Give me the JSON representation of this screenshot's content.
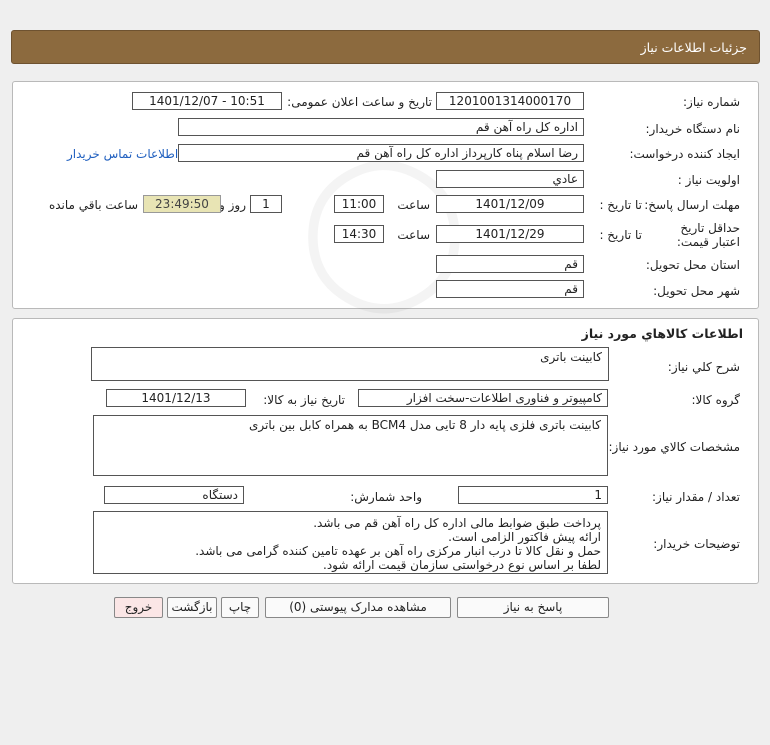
{
  "header": {
    "title": "جزئیات اطلاعات نیاز"
  },
  "need": {
    "need_number_label": "شماره نیاز:",
    "need_number": "1201001314000170",
    "announce_label": "تاریخ و ساعت اعلان عمومی:",
    "announce_value": "1401/12/07 - 10:51",
    "buyer_org_label": "نام دستگاه خریدار:",
    "buyer_org": "اداره کل  راه آهن قم",
    "creator_label": "ایجاد کننده درخواست:",
    "creator": "رضا اسلام پناه کارپرداز اداره کل  راه آهن قم",
    "contact_link": "اطلاعات تماس خریدار",
    "priority_label": "اولویت نیاز :",
    "priority": "عادي",
    "deadline_label": "مهلت ارسال پاسخ:",
    "until_date_label": "تا تاریخ :",
    "deadline_date": "1401/12/09",
    "time_label": "ساعت",
    "deadline_time": "11:00",
    "days_value": "1",
    "days_label": "روز و",
    "remaining_time": "23:49:50",
    "remaining_label": "ساعت باقي مانده",
    "validity_label": "حداقل تاریخ اعتبار قیمت:",
    "validity_date": "1401/12/29",
    "validity_time": "14:30",
    "province_label": "استان محل تحویل:",
    "province": "قم",
    "city_label": "شهر محل تحویل:",
    "city": "قم"
  },
  "goods": {
    "section_title": "اطلاعات کالاهاي مورد نياز",
    "summary_label": "شرح کلي نياز:",
    "summary": "کابینت باتری",
    "group_label": "گروه کالا:",
    "group": "کامپیوتر و فناوری اطلاعات-سخت افزار",
    "need_date_label": "تاريخ نياز به کالا:",
    "need_date": "1401/12/13",
    "specs_label": "مشخصات کالاي مورد نياز:",
    "specs": "کابینت باتری فلزی پایه دار 8 تایی مدل BCM4 به همراه کابل بین باتری",
    "qty_label": "تعداد / مقدار نياز:",
    "qty": "1",
    "unit_label": "واحد شمارش:",
    "unit": "دستگاه",
    "notes_label": "توضيحات خريدار:",
    "notes": [
      "پرداخت طبق ضوابط مالی اداره کل راه آهن قم می باشد.",
      "ارائه پیش فاکتور الزامی است.",
      "حمل و نقل کالا تا درب انبار مرکزی راه آهن بر عهده تامین کننده گرامی می باشد.",
      "لطفا بر اساس نوع درخواستی سازمان قیمت ارائه شود."
    ]
  },
  "buttons": {
    "reply": "پاسخ به نياز",
    "attachments": "مشاهده مدارک پیوستی (0)",
    "print": "چاپ",
    "back": "بازگشت",
    "exit": "خروج"
  },
  "watermark": {
    "brand": "ParsNamadData",
    "line1": "مرکز فراوری اطلاعات پارس نماد داده ها",
    "line2": "پایگاه اطلاع رسانی مناقصه و مزایده",
    "phone": "021 - 88349670"
  },
  "colors": {
    "header_bg": "#8c6a3e",
    "highlight_bg": "#e8e4b4",
    "link": "#1f5fbf",
    "exit_bg": "#fbe6e6"
  }
}
